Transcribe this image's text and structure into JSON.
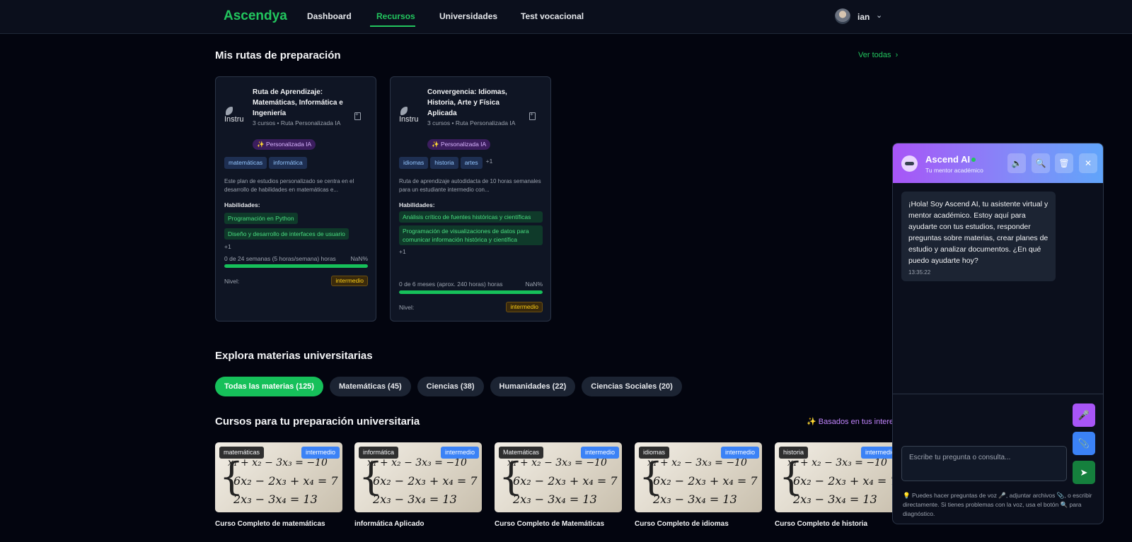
{
  "header": {
    "logo": "Ascendya",
    "nav": [
      "Dashboard",
      "Recursos",
      "Universidades",
      "Test vocacional"
    ],
    "active_nav": "Recursos",
    "user_name": "ian"
  },
  "routes_section": {
    "title": "Mis rutas de preparación",
    "see_all": "Ver todas",
    "cards": [
      {
        "thumb_alt": "Instru",
        "title": "Ruta de Aprendizaje: Matemáticas, Informática e Ingeniería",
        "meta": "3 cursos • Ruta Personalizada IA",
        "badge": "✨ Personalizada IA",
        "tags": [
          "matemáticas",
          "informática"
        ],
        "tags_more": "",
        "description": "Este plan de estudios personalizado se centra en el desarrollo de habilidades en matemáticas e...",
        "skills_label": "Habilidades:",
        "skills": [
          "Programación en Python",
          "Diseño y desarrollo de interfaces de usuario"
        ],
        "skills_more": "+1",
        "progress_text": "0 de 24 semanas (5 horas/semana) horas",
        "progress_pct_label": "NaN%",
        "progress": 1.0,
        "level_label": "Nivel:",
        "level": "intermedio"
      },
      {
        "thumb_alt": "Instru",
        "title": "Convergencia: Idiomas, Historia, Arte y Física Aplicada",
        "meta": "3 cursos • Ruta Personalizada IA",
        "badge": "✨ Personalizada IA",
        "tags": [
          "idiomas",
          "historia",
          "artes"
        ],
        "tags_more": "+1",
        "description": "Ruta de aprendizaje autodidacta de 10 horas semanales para un estudiante intermedio con...",
        "skills_label": "Habilidades:",
        "skills": [
          "Análisis crítico de fuentes históricas y científicas",
          "Programación de visualizaciones de datos para comunicar información histórica y científica"
        ],
        "skills_more": "+1",
        "progress_text": "0 de 6 meses (aprox. 240 horas) horas",
        "progress_pct_label": "NaN%",
        "progress": 1.0,
        "level_label": "Nivel:",
        "level": "intermedio"
      }
    ]
  },
  "explore": {
    "title": "Explora materias universitarias",
    "filters": [
      "Todas las materias (125)",
      "Matemáticas (45)",
      "Ciencias (38)",
      "Humanidades (22)",
      "Ciencias Sociales (20)"
    ],
    "active_filter": "Todas las materias (125)"
  },
  "courses_section": {
    "title": "Cursos para tu preparación universitaria",
    "based_on": "✨ Basados en tus interes",
    "equation": [
      "x₁ + x₂ − 3x₃ = −10",
      "6x₂ − 2x₃ + x₄ = 7",
      "2x₃ − 3x₄ = 13"
    ],
    "courses": [
      {
        "subject": "matemáticas",
        "level": "intermedio",
        "title": "Curso Completo de matemáticas"
      },
      {
        "subject": "informática",
        "level": "intermedio",
        "title": "informática Aplicado"
      },
      {
        "subject": "Matemáticas",
        "level": "intermedio",
        "title": "Curso Completo de Matemáticas"
      },
      {
        "subject": "idiomas",
        "level": "intermedio",
        "title": "Curso Completo de idiomas"
      },
      {
        "subject": "historia",
        "level": "intermedio",
        "title": "Curso Completo de historia"
      }
    ]
  },
  "chat": {
    "name": "Ascend AI",
    "subtitle": "Tu mentor académico",
    "header_buttons": [
      "speaker-icon",
      "search-icon",
      "trash-icon",
      "close-icon"
    ],
    "message": "¡Hola! Soy Ascend AI, tu asistente virtual y mentor académico. Estoy aquí para ayudarte con tus estudios, responder preguntas sobre materias, crear planes de estudio y analizar documentos. ¿En qué puedo ayudarte hoy?",
    "message_time": "13:35:22",
    "action_buttons": [
      "microphone-icon",
      "paperclip-icon",
      "send-icon"
    ],
    "input_placeholder": "Escribe tu pregunta o consulta...",
    "hint": "💡 Puedes hacer preguntas de voz 🎤, adjuntar archivos 📎, o escribir directamente. Si tienes problemas con la voz, usa el botón 🔍 para diagnóstico."
  },
  "colors": {
    "accent": "#22c55e",
    "background": "#03050f",
    "card": "#0f1524",
    "chat_gradient_start": "#a855f7",
    "chat_gradient_end": "#60a5fa",
    "level_badge": "#3b82f6"
  }
}
